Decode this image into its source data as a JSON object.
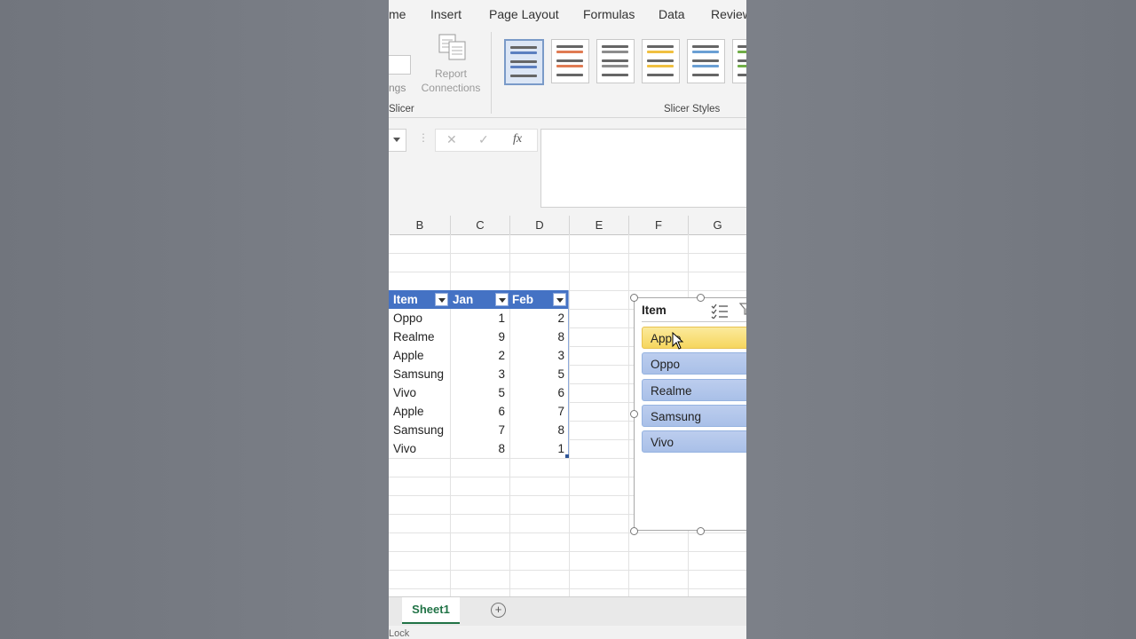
{
  "ribbon": {
    "tabs": [
      "me",
      "Insert",
      "Page Layout",
      "Formulas",
      "Data",
      "Review"
    ],
    "partial_button_label": "ngs",
    "report_connections": [
      "Report",
      "Connections"
    ],
    "group_slicer": "Slicer",
    "group_slicer_styles": "Slicer Styles",
    "style_colors": [
      "#5b7fc0",
      "#e07b53",
      "#8c8c8c",
      "#f0c040",
      "#6a9fd4",
      "#70ad47"
    ]
  },
  "formula_bar": {
    "cancel_glyph": "✕",
    "enter_glyph": "✓",
    "fx_label": "fx",
    "value": ""
  },
  "columns": [
    "B",
    "C",
    "D",
    "E",
    "F",
    "G"
  ],
  "table": {
    "headers": [
      "Item",
      "Jan",
      "Feb"
    ],
    "rows": [
      [
        "Oppo",
        "1",
        "2"
      ],
      [
        "Realme",
        "9",
        "8"
      ],
      [
        "Apple",
        "2",
        "3"
      ],
      [
        "Samsung",
        "3",
        "5"
      ],
      [
        "Vivo",
        "5",
        "6"
      ],
      [
        "Apple",
        "6",
        "7"
      ],
      [
        "Samsung",
        "7",
        "8"
      ],
      [
        "Vivo",
        "8",
        "1"
      ]
    ],
    "header_color": "#4472c4"
  },
  "slicer": {
    "title": "Item",
    "items": [
      "Apple",
      "Oppo",
      "Realme",
      "Samsung",
      "Vivo"
    ],
    "selected": "Apple"
  },
  "sheet": {
    "active_tab": "Sheet1",
    "add_glyph": "+"
  },
  "status": {
    "text": "Lock"
  }
}
